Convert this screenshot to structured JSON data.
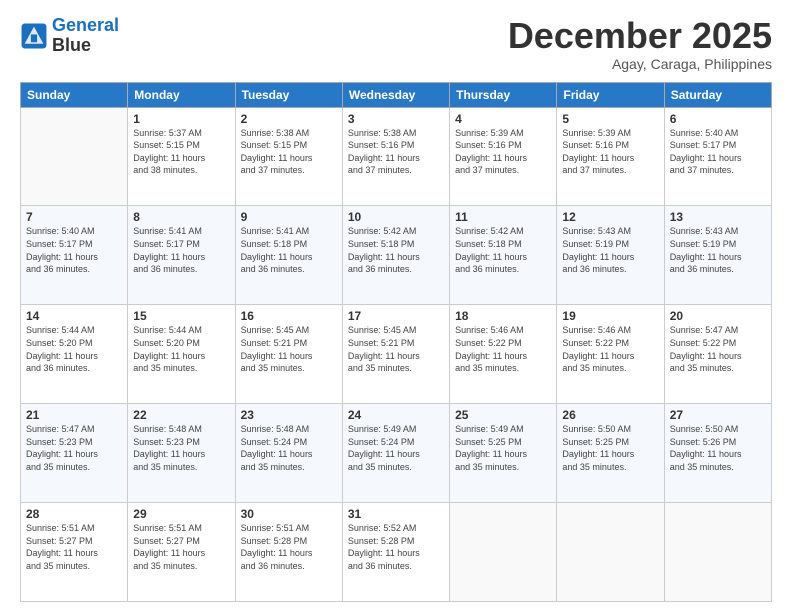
{
  "logo": {
    "line1": "General",
    "line2": "Blue"
  },
  "title": "December 2025",
  "subtitle": "Agay, Caraga, Philippines",
  "days_header": [
    "Sunday",
    "Monday",
    "Tuesday",
    "Wednesday",
    "Thursday",
    "Friday",
    "Saturday"
  ],
  "weeks": [
    [
      {
        "day": "",
        "info": ""
      },
      {
        "day": "1",
        "info": "Sunrise: 5:37 AM\nSunset: 5:15 PM\nDaylight: 11 hours\nand 38 minutes."
      },
      {
        "day": "2",
        "info": "Sunrise: 5:38 AM\nSunset: 5:15 PM\nDaylight: 11 hours\nand 37 minutes."
      },
      {
        "day": "3",
        "info": "Sunrise: 5:38 AM\nSunset: 5:16 PM\nDaylight: 11 hours\nand 37 minutes."
      },
      {
        "day": "4",
        "info": "Sunrise: 5:39 AM\nSunset: 5:16 PM\nDaylight: 11 hours\nand 37 minutes."
      },
      {
        "day": "5",
        "info": "Sunrise: 5:39 AM\nSunset: 5:16 PM\nDaylight: 11 hours\nand 37 minutes."
      },
      {
        "day": "6",
        "info": "Sunrise: 5:40 AM\nSunset: 5:17 PM\nDaylight: 11 hours\nand 37 minutes."
      }
    ],
    [
      {
        "day": "7",
        "info": "Sunrise: 5:40 AM\nSunset: 5:17 PM\nDaylight: 11 hours\nand 36 minutes."
      },
      {
        "day": "8",
        "info": "Sunrise: 5:41 AM\nSunset: 5:17 PM\nDaylight: 11 hours\nand 36 minutes."
      },
      {
        "day": "9",
        "info": "Sunrise: 5:41 AM\nSunset: 5:18 PM\nDaylight: 11 hours\nand 36 minutes."
      },
      {
        "day": "10",
        "info": "Sunrise: 5:42 AM\nSunset: 5:18 PM\nDaylight: 11 hours\nand 36 minutes."
      },
      {
        "day": "11",
        "info": "Sunrise: 5:42 AM\nSunset: 5:18 PM\nDaylight: 11 hours\nand 36 minutes."
      },
      {
        "day": "12",
        "info": "Sunrise: 5:43 AM\nSunset: 5:19 PM\nDaylight: 11 hours\nand 36 minutes."
      },
      {
        "day": "13",
        "info": "Sunrise: 5:43 AM\nSunset: 5:19 PM\nDaylight: 11 hours\nand 36 minutes."
      }
    ],
    [
      {
        "day": "14",
        "info": "Sunrise: 5:44 AM\nSunset: 5:20 PM\nDaylight: 11 hours\nand 36 minutes."
      },
      {
        "day": "15",
        "info": "Sunrise: 5:44 AM\nSunset: 5:20 PM\nDaylight: 11 hours\nand 35 minutes."
      },
      {
        "day": "16",
        "info": "Sunrise: 5:45 AM\nSunset: 5:21 PM\nDaylight: 11 hours\nand 35 minutes."
      },
      {
        "day": "17",
        "info": "Sunrise: 5:45 AM\nSunset: 5:21 PM\nDaylight: 11 hours\nand 35 minutes."
      },
      {
        "day": "18",
        "info": "Sunrise: 5:46 AM\nSunset: 5:22 PM\nDaylight: 11 hours\nand 35 minutes."
      },
      {
        "day": "19",
        "info": "Sunrise: 5:46 AM\nSunset: 5:22 PM\nDaylight: 11 hours\nand 35 minutes."
      },
      {
        "day": "20",
        "info": "Sunrise: 5:47 AM\nSunset: 5:22 PM\nDaylight: 11 hours\nand 35 minutes."
      }
    ],
    [
      {
        "day": "21",
        "info": "Sunrise: 5:47 AM\nSunset: 5:23 PM\nDaylight: 11 hours\nand 35 minutes."
      },
      {
        "day": "22",
        "info": "Sunrise: 5:48 AM\nSunset: 5:23 PM\nDaylight: 11 hours\nand 35 minutes."
      },
      {
        "day": "23",
        "info": "Sunrise: 5:48 AM\nSunset: 5:24 PM\nDaylight: 11 hours\nand 35 minutes."
      },
      {
        "day": "24",
        "info": "Sunrise: 5:49 AM\nSunset: 5:24 PM\nDaylight: 11 hours\nand 35 minutes."
      },
      {
        "day": "25",
        "info": "Sunrise: 5:49 AM\nSunset: 5:25 PM\nDaylight: 11 hours\nand 35 minutes."
      },
      {
        "day": "26",
        "info": "Sunrise: 5:50 AM\nSunset: 5:25 PM\nDaylight: 11 hours\nand 35 minutes."
      },
      {
        "day": "27",
        "info": "Sunrise: 5:50 AM\nSunset: 5:26 PM\nDaylight: 11 hours\nand 35 minutes."
      }
    ],
    [
      {
        "day": "28",
        "info": "Sunrise: 5:51 AM\nSunset: 5:27 PM\nDaylight: 11 hours\nand 35 minutes."
      },
      {
        "day": "29",
        "info": "Sunrise: 5:51 AM\nSunset: 5:27 PM\nDaylight: 11 hours\nand 35 minutes."
      },
      {
        "day": "30",
        "info": "Sunrise: 5:51 AM\nSunset: 5:28 PM\nDaylight: 11 hours\nand 36 minutes."
      },
      {
        "day": "31",
        "info": "Sunrise: 5:52 AM\nSunset: 5:28 PM\nDaylight: 11 hours\nand 36 minutes."
      },
      {
        "day": "",
        "info": ""
      },
      {
        "day": "",
        "info": ""
      },
      {
        "day": "",
        "info": ""
      }
    ]
  ]
}
